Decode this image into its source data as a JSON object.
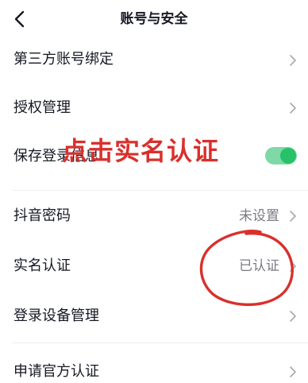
{
  "nav": {
    "title": "账号与安全",
    "back_icon": "chevron-left-icon"
  },
  "rows": [
    {
      "label": "第三方账号绑定",
      "value": "",
      "control": "chevron"
    },
    {
      "label": "授权管理",
      "value": "",
      "control": "chevron"
    },
    {
      "label": "保存登录信息",
      "value": "",
      "control": "toggle",
      "toggle_on": true
    },
    {
      "label": "抖音密码",
      "value": "未设置",
      "control": "chevron"
    },
    {
      "label": "实名认证",
      "value": "已认证",
      "control": "chevron"
    },
    {
      "label": "登录设备管理",
      "value": "",
      "control": "chevron"
    },
    {
      "label": "申请官方认证",
      "value": "",
      "control": "chevron"
    }
  ],
  "annotation": {
    "text": "点击实名认证",
    "color": "#d9302c"
  },
  "colors": {
    "toggle_track": "#7ed9a6",
    "toggle_knob": "#27c268",
    "value_text": "#7b7c82",
    "label_text": "#161823"
  }
}
